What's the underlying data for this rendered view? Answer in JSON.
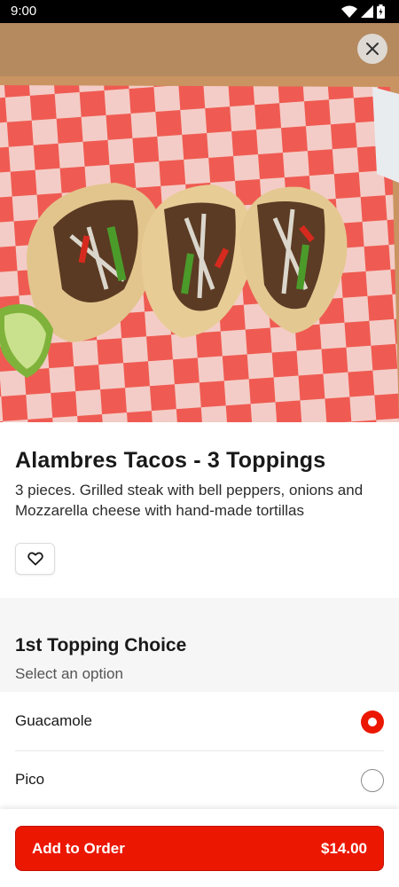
{
  "status_bar": {
    "time": "9:00",
    "icons": [
      "wifi-icon",
      "signal-icon",
      "battery-icon"
    ]
  },
  "item": {
    "title": "Alambres Tacos - 3 Toppings",
    "description": "3 pieces. Grilled steak with bell peppers, onions and Mozzarella cheese with hand-made tortillas",
    "hero_image": "photo of three tacos on a red and white checkered paper with a lime wedge"
  },
  "section": {
    "title": "1st Topping Choice",
    "subtitle": "Select an option",
    "options": [
      {
        "label": "Guacamole",
        "selected": true
      },
      {
        "label": "Pico",
        "selected": false
      }
    ]
  },
  "footer": {
    "button_label": "Add to Order",
    "price": "$14.00"
  },
  "colors": {
    "accent": "#eb1700",
    "section_bg": "#f6f6f6"
  }
}
